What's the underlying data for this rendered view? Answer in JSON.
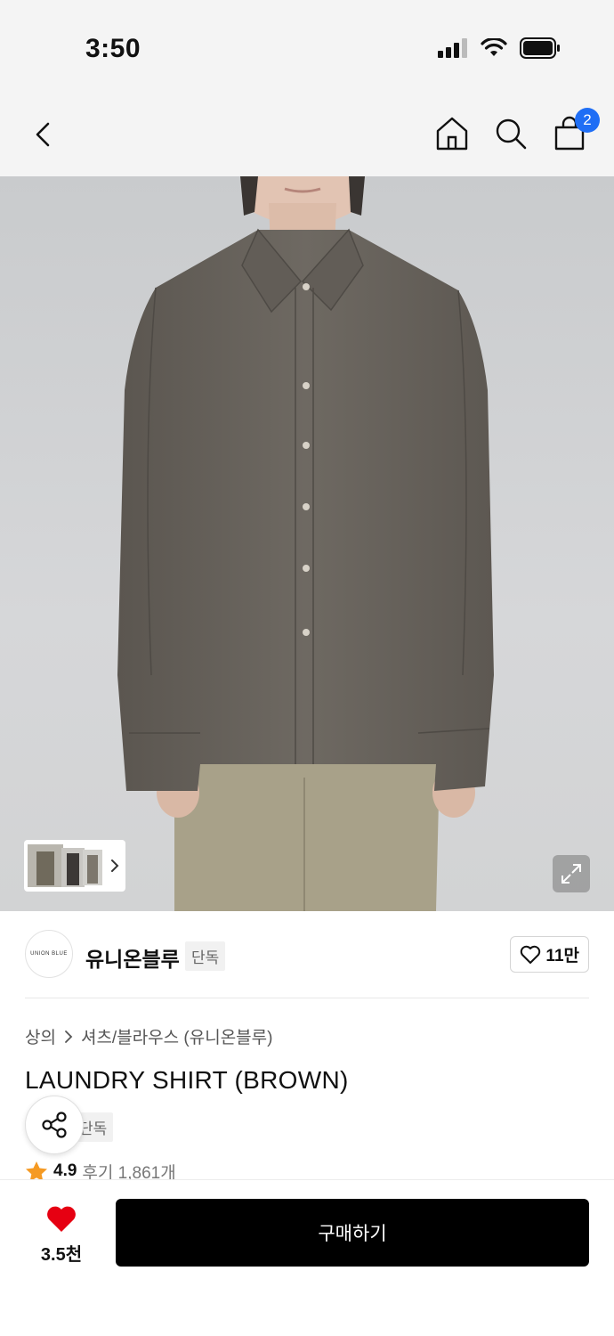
{
  "status_bar": {
    "time": "3:50"
  },
  "nav": {
    "cart_count": "2"
  },
  "hero": {
    "image_alt": ""
  },
  "brand": {
    "name": "유니온블루",
    "logo_text": "UNION BLUE",
    "tag": "단독",
    "likes": "11만"
  },
  "breadcrumb": {
    "category": "상의",
    "subcategory": "셔츠/블라우스 (유니온블루)"
  },
  "product": {
    "title": "LAUNDRY SHIRT (BROWN)",
    "exclusive_tag": "단독",
    "rating": "4.9",
    "reviews": "후기 1,861개"
  },
  "bottom": {
    "favorite_count": "3.5천",
    "buy_label": "구매하기"
  },
  "colors": {
    "accent_blue": "#1f6ef5",
    "heart_red": "#e60012",
    "star_orange": "#f59a23"
  }
}
